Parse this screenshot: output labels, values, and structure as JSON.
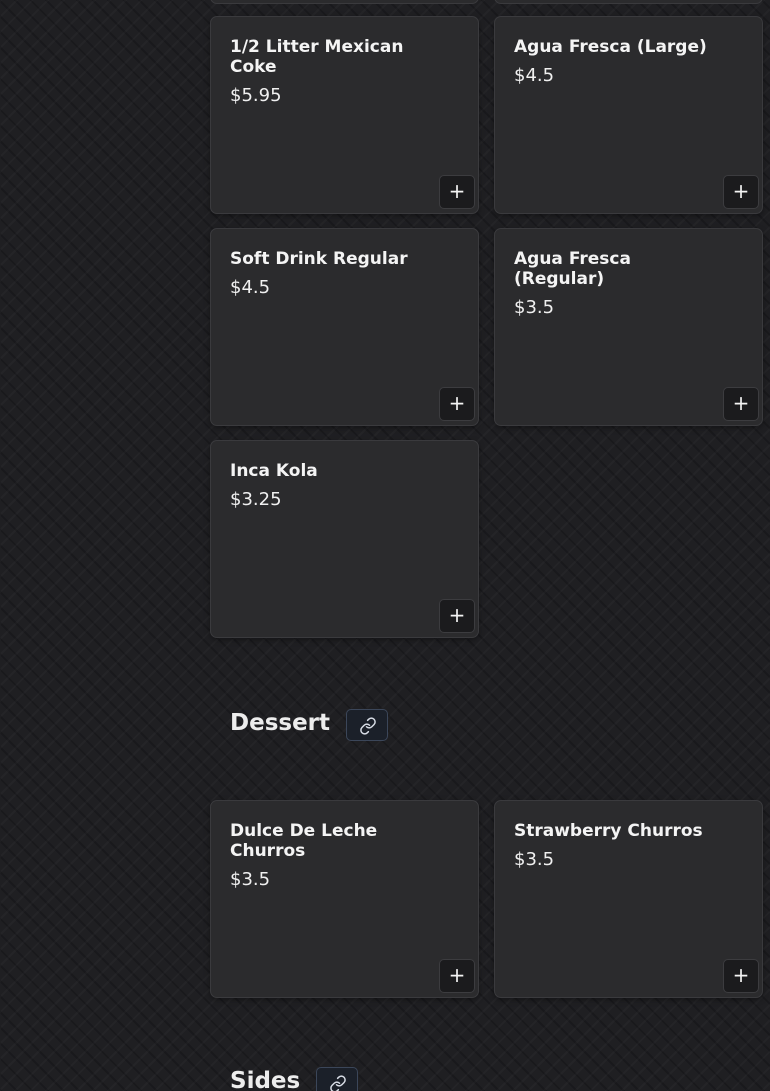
{
  "drinks": {
    "items": [
      {
        "name": "1/2 Litter Mexican Coke",
        "price": "$5.95"
      },
      {
        "name": "Agua Fresca (Large)",
        "price": "$4.5"
      },
      {
        "name": "Soft Drink Regular",
        "price": "$4.5"
      },
      {
        "name": "Agua Fresca (Regular)",
        "price": "$3.5"
      },
      {
        "name": "Inca Kola",
        "price": "$3.25"
      }
    ]
  },
  "dessert": {
    "title": "Dessert",
    "items": [
      {
        "name": "Dulce De Leche Churros",
        "price": "$3.5"
      },
      {
        "name": "Strawberry Churros",
        "price": "$3.5"
      }
    ]
  },
  "sides": {
    "title": "Sides"
  },
  "buttons": {
    "add_label": "+",
    "add_icon": "plus-icon",
    "link_icon": "link-icon"
  },
  "colors": {
    "background": "#1f1f22",
    "card": "#2b2b2d",
    "button": "#1b1b1d",
    "link_button": "#1b2029",
    "text": "#f2f2f2"
  }
}
